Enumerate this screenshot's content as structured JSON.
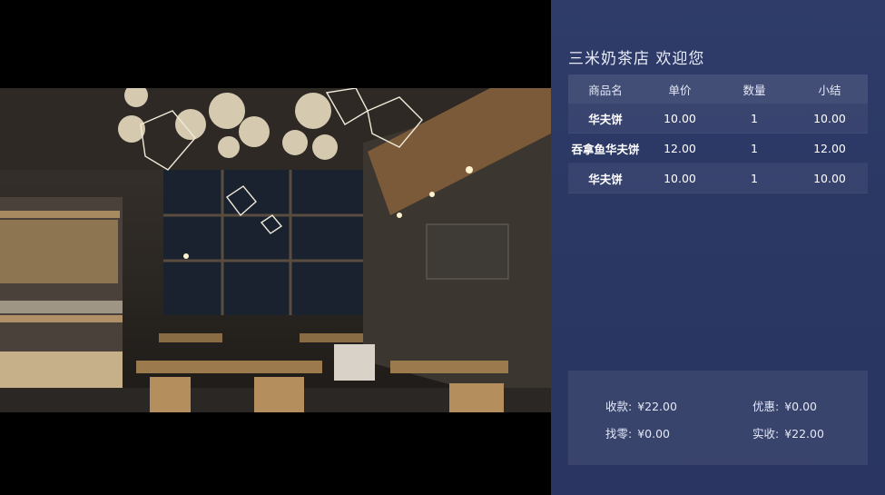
{
  "store_title": "三米奶茶店 欢迎您",
  "table": {
    "headers": [
      "商品名",
      "单价",
      "数量",
      "小结"
    ],
    "rows": [
      {
        "name": "华夫饼",
        "price": "10.00",
        "qty": "1",
        "subtotal": "10.00"
      },
      {
        "name": "吞拿鱼华夫饼",
        "price": "12.00",
        "qty": "1",
        "subtotal": "12.00"
      },
      {
        "name": "华夫饼",
        "price": "10.00",
        "qty": "1",
        "subtotal": "10.00"
      }
    ]
  },
  "summary": {
    "received_label": "收款:",
    "received_value": "¥22.00",
    "discount_label": "优惠:",
    "discount_value": "¥0.00",
    "change_label": "找零:",
    "change_value": "¥0.00",
    "actual_label": "实收:",
    "actual_value": "¥22.00"
  }
}
